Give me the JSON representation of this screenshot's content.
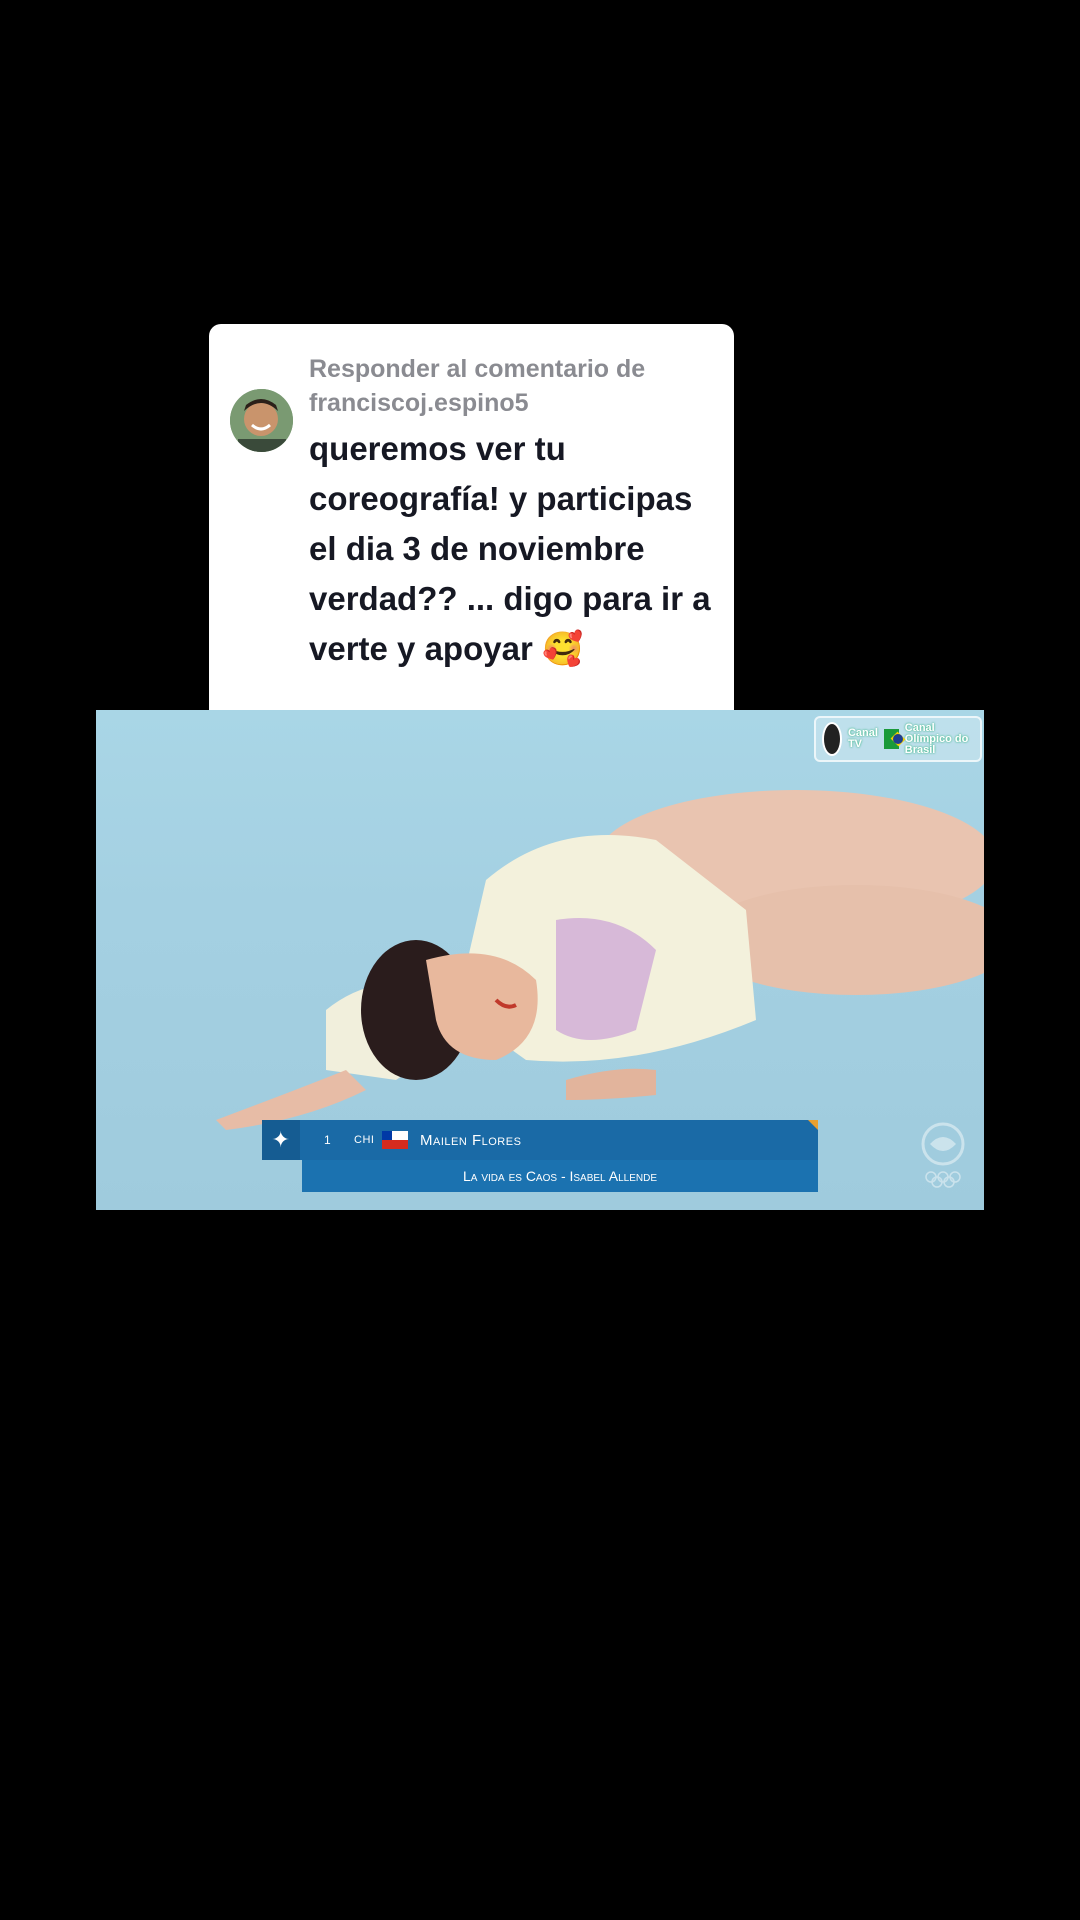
{
  "reply_bubble": {
    "header": "Responder al comentario de franciscoj.espino5",
    "comment": "queremos ver tu coreografía! y participas el dia 3 de noviembre verdad?? ... digo para ir a verte y apoyar 🥰"
  },
  "video": {
    "broadcaster_label": "Canal TV",
    "broadcaster_label_2": "Canal Olímpico do Brasil",
    "lower_third": {
      "rank": "1",
      "country": "CHI",
      "athlete": "Mailen Flores",
      "routine": "La vida es Caos - Isabel Allende"
    }
  },
  "colors": {
    "background": "#000000",
    "bubble": "#ffffff",
    "header_text": "#8a8b91",
    "comment_text": "#161823",
    "lower_third": "#1a6aa6"
  }
}
